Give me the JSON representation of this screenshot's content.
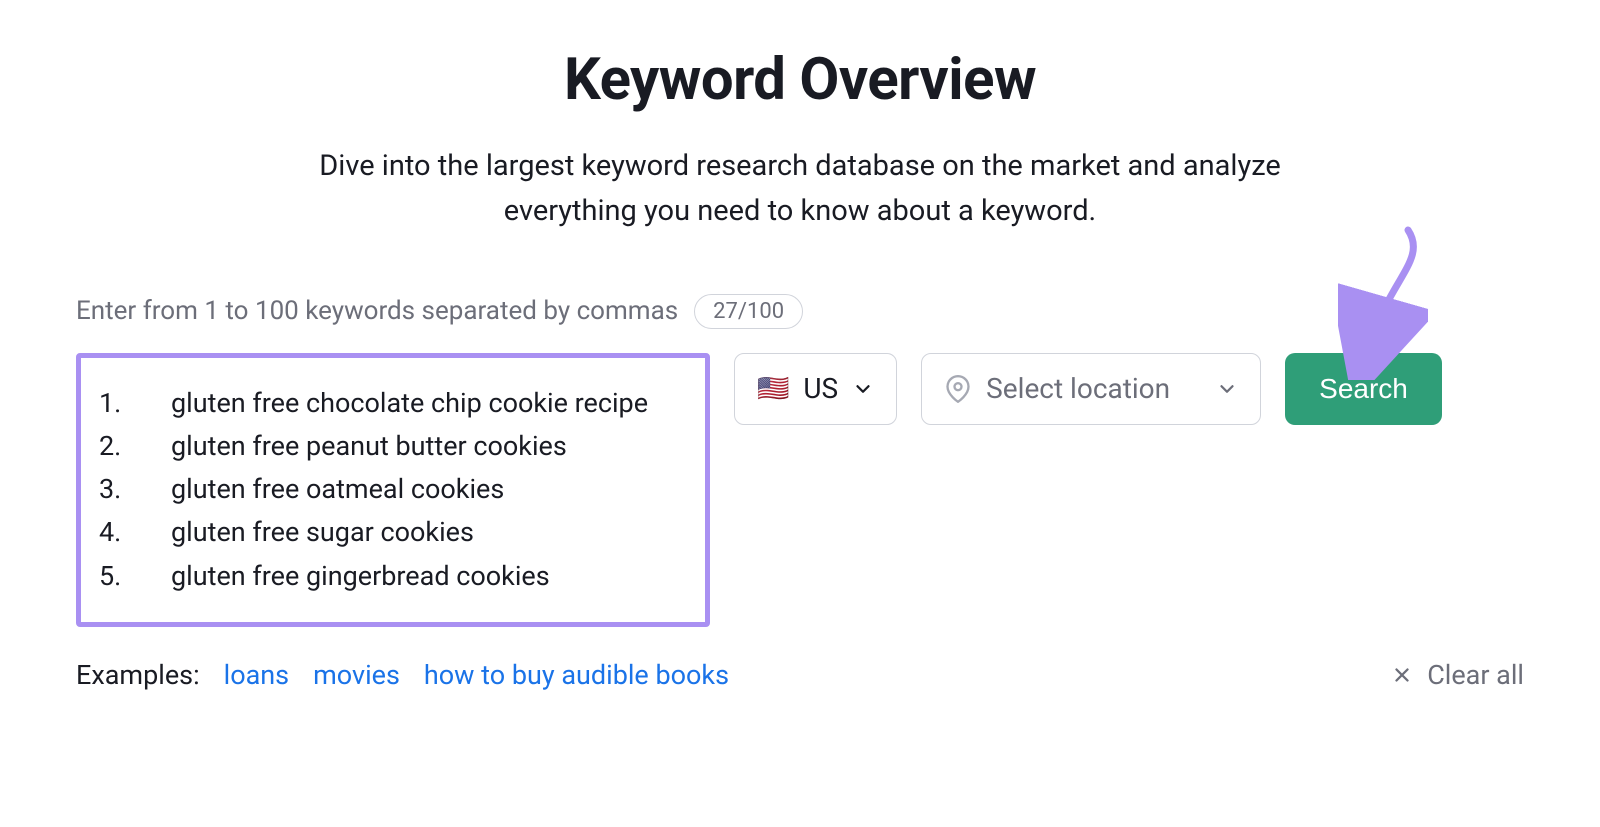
{
  "header": {
    "title": "Keyword Overview",
    "subtitle": "Dive into the largest keyword research database on the market and analyze everything you need to know about a keyword."
  },
  "input": {
    "meta_label": "Enter from 1 to 100 keywords separated by commas",
    "counter": "27/100",
    "keywords": [
      "gluten free chocolate chip cookie recipe",
      "gluten free peanut butter cookies",
      "gluten free oatmeal cookies",
      "gluten free sugar cookies",
      "gluten free gingerbread cookies"
    ]
  },
  "country": {
    "flag": "🇺🇸",
    "label": "US"
  },
  "location": {
    "placeholder": "Select location"
  },
  "search_button": "Search",
  "examples": {
    "label": "Examples:",
    "items": [
      "loans",
      "movies",
      "how to buy audible books"
    ]
  },
  "clear_all": "Clear all",
  "annotation": {
    "arrow_color": "#a990f2"
  }
}
